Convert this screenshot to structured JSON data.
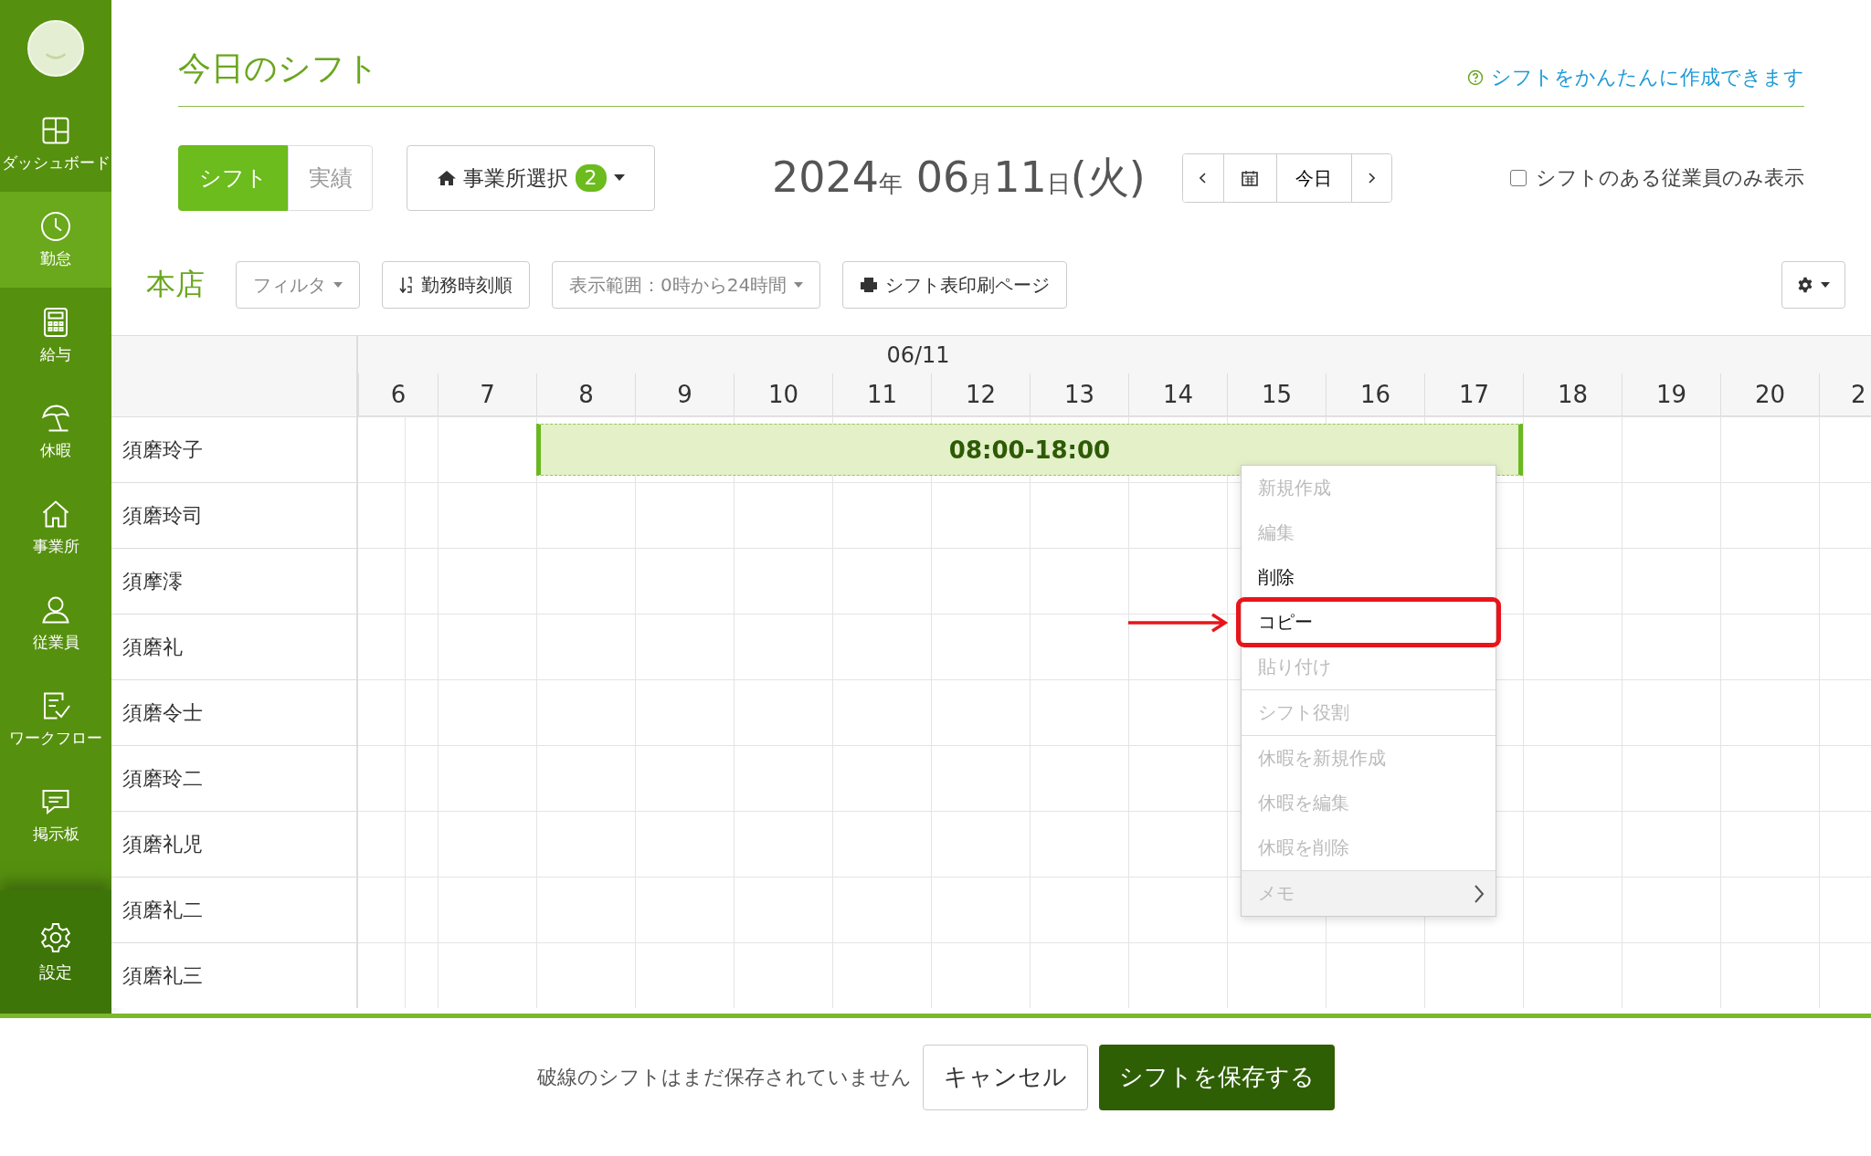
{
  "sidebar": {
    "items": [
      {
        "label": "ダッシュボード",
        "selected": false
      },
      {
        "label": "勤怠",
        "selected": true
      },
      {
        "label": "給与",
        "selected": false
      },
      {
        "label": "休暇",
        "selected": false
      },
      {
        "label": "事業所",
        "selected": false
      },
      {
        "label": "従業員",
        "selected": false
      },
      {
        "label": "ワークフロー",
        "selected": false
      },
      {
        "label": "掲示板",
        "selected": false
      }
    ],
    "settings": {
      "label": "設定"
    }
  },
  "header": {
    "title": "今日のシフト",
    "help_link": "シフトをかんたんに作成できます"
  },
  "mode_tabs": [
    {
      "label": "シフト",
      "selected": true
    },
    {
      "label": "実績",
      "selected": false
    }
  ],
  "office_select": {
    "label": "事業所選択",
    "count": "2"
  },
  "date": {
    "year": "2024",
    "year_unit": "年",
    "month": "06",
    "month_unit": "月",
    "day": "11",
    "day_unit": "日",
    "weekday": "(火)"
  },
  "date_nav": {
    "today": "今日"
  },
  "only_with_shifts": {
    "label": "シフトのある従業員のみ表示",
    "checked": false
  },
  "toolbar": {
    "store": "本店",
    "filter": "フィルタ",
    "sort": "勤務時刻順",
    "range": "表示範囲：0時から24時間",
    "print": "シフト表印刷ページ"
  },
  "timeline": {
    "date": "06/11",
    "hours": [
      "6",
      "7",
      "8",
      "9",
      "10",
      "11",
      "12",
      "13",
      "14",
      "15",
      "16",
      "17",
      "18",
      "19",
      "20",
      "2"
    ],
    "employees": [
      "須磨玲子",
      "須磨玲司",
      "須摩澪",
      "須磨礼",
      "須磨令士",
      "須磨玲二",
      "須磨礼児",
      "須磨礼二",
      "須磨礼三"
    ],
    "shift": {
      "label": "08:00-18:00"
    }
  },
  "context_menu": {
    "sections": [
      {
        "items": [
          {
            "label": "新規作成",
            "disabled": true,
            "callout": false
          },
          {
            "label": "編集",
            "disabled": true,
            "callout": false
          },
          {
            "label": "削除",
            "disabled": false,
            "callout": false
          },
          {
            "label": "コピー",
            "disabled": false,
            "callout": true
          },
          {
            "label": "貼り付け",
            "disabled": true,
            "callout": false
          }
        ]
      },
      {
        "items": [
          {
            "label": "シフト役割",
            "disabled": true,
            "callout": false
          }
        ]
      },
      {
        "items": [
          {
            "label": "休暇を新規作成",
            "disabled": true,
            "callout": false
          },
          {
            "label": "休暇を編集",
            "disabled": true,
            "callout": false
          },
          {
            "label": "休暇を削除",
            "disabled": true,
            "callout": false
          }
        ]
      },
      {
        "items": [
          {
            "label": "メモ",
            "disabled": true,
            "callout": false,
            "kind": "submenu"
          }
        ]
      }
    ]
  },
  "footer": {
    "message": "破線のシフトはまだ保存されていません",
    "cancel": "キャンセル",
    "save": "シフトを保存する"
  }
}
